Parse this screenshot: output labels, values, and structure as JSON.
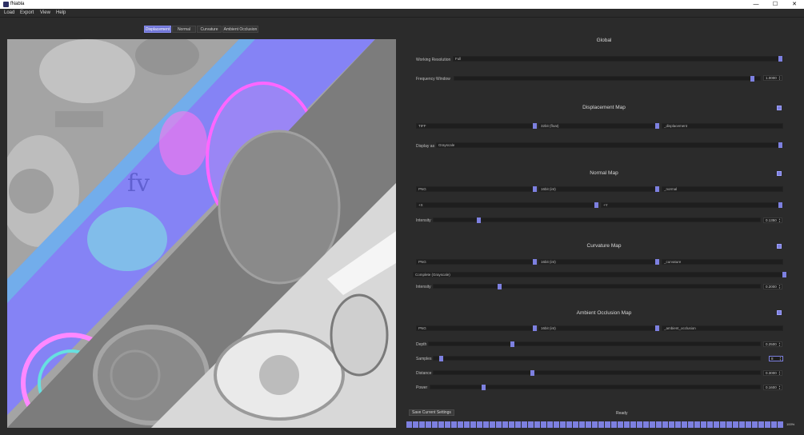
{
  "window": {
    "title": "fNabla",
    "minimize": "—",
    "maximize": "☐",
    "close": "✕"
  },
  "menu": [
    "Load",
    "Export",
    "View",
    "Help"
  ],
  "tabs": [
    "Displacement",
    "Normal",
    "Curvature",
    "Ambient Occlusion"
  ],
  "active_tab": "Displacement",
  "global": {
    "title": "Global",
    "working_resolution": {
      "label": "Working Resolution",
      "value": "Full"
    },
    "frequency_window": {
      "label": "Frequency Window",
      "value": "1.0000",
      "level": 0.98
    }
  },
  "displacement": {
    "title": "Displacement Map",
    "enabled": true,
    "format": "TIFF",
    "depth": "32bit (float)",
    "suffix": "_displacement",
    "display_as": {
      "label": "Display as",
      "value": "Grayscale"
    }
  },
  "normal": {
    "title": "Normal Map",
    "enabled": true,
    "format": "PNG",
    "depth": "16bit (int)",
    "suffix": "_normal",
    "x_axis": "+X",
    "y_axis": "+Y",
    "intensity": {
      "label": "Intensity",
      "value": "0.1350",
      "level": 0.135
    }
  },
  "curvature": {
    "title": "Curvature Map",
    "enabled": true,
    "format": "PNG",
    "depth": "16bit (int)",
    "suffix": "_curvature",
    "mode": "Complete (Grayscale)",
    "intensity": {
      "label": "Intensity",
      "value": "0.2000",
      "level": 0.2
    }
  },
  "ao": {
    "title": "Ambient Occlusion Map",
    "enabled": true,
    "format": "PNG",
    "depth": "16bit (int)",
    "suffix": "_ambient_occlusion",
    "depth_param": {
      "label": "Depth",
      "value": "0.2500",
      "level": 0.25
    },
    "samples": {
      "label": "Samples",
      "value": "8",
      "level": 0.02
    },
    "distance": {
      "label": "Distance",
      "value": "0.3000",
      "level": 0.3
    },
    "power": {
      "label": "Power",
      "value": "0.1600",
      "level": 0.16
    }
  },
  "footer": {
    "save_label": "Save Current Settings",
    "status": "Ready",
    "progress": "100%",
    "progress_level": 1.0
  },
  "colors": {
    "accent": "#7d80e0",
    "background": "#2b2b2b",
    "field": "#1e1e1e"
  },
  "icons": [
    "app-logo-icon",
    "minimize-icon",
    "maximize-icon",
    "close-icon",
    "spin-arrows-icon"
  ]
}
